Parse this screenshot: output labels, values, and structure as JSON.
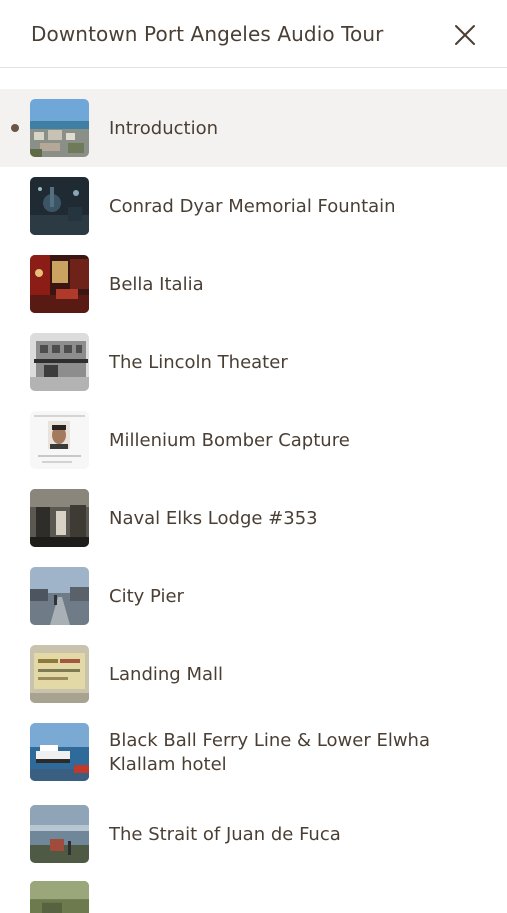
{
  "header": {
    "title": "Downtown Port Angeles Audio Tour"
  },
  "tour": {
    "active_index": 0,
    "stops": [
      {
        "label": "Introduction",
        "thumb": "harbor-aerial-photo"
      },
      {
        "label": "Conrad Dyar Memorial Fountain",
        "thumb": "fountain-night-photo"
      },
      {
        "label": "Bella Italia",
        "thumb": "restaurant-interior-photo"
      },
      {
        "label": "The Lincoln Theater",
        "thumb": "theater-building-photo"
      },
      {
        "label": "Millenium Bomber Capture",
        "thumb": "mugshot-document-photo"
      },
      {
        "label": "Naval Elks Lodge #353",
        "thumb": "historic-lodge-photo"
      },
      {
        "label": "City Pier",
        "thumb": "pier-street-photo"
      },
      {
        "label": "Landing Mall",
        "thumb": "vintage-sign-photo"
      },
      {
        "label": "Black Ball Ferry Line & Lower Elwha Klallam hotel",
        "thumb": "ferry-water-photo"
      },
      {
        "label": "The Strait of Juan de Fuca",
        "thumb": "strait-overlook-photo"
      }
    ]
  },
  "colors": {
    "text": "#4a3f35",
    "active_row": "#f3f2f1",
    "active_dot": "#6b5646",
    "divider": "#e6e2dd"
  }
}
